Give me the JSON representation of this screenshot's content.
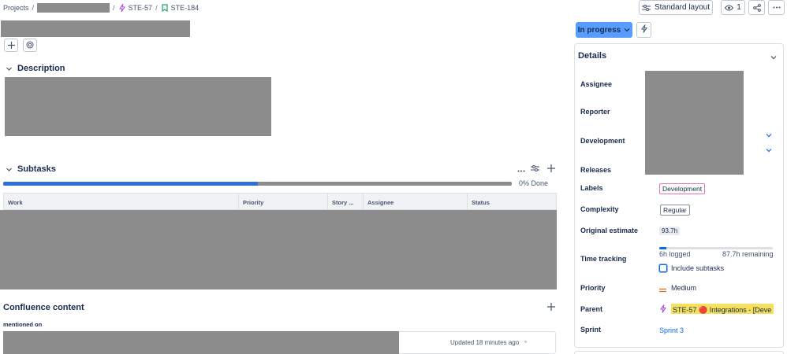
{
  "breadcrumb": {
    "projects": "Projects",
    "parent_key": "STE-57",
    "issue_key": "STE-184"
  },
  "header": {
    "layout_label": "Standard layout",
    "watchers_count": "1"
  },
  "description": {
    "title": "Description"
  },
  "subtasks": {
    "title": "Subtasks",
    "progress_text": "0% Done",
    "progress_fraction": 0.5,
    "columns": [
      "Work",
      "Priority",
      "Story ...",
      "Assignee",
      "Status"
    ]
  },
  "confluence": {
    "title": "Confluence content",
    "mentioned_label": "mentioned on",
    "updated_text": "Updated 18 minutes ago"
  },
  "status": {
    "label": "In progress"
  },
  "details": {
    "title": "Details",
    "assignee_label": "Assignee",
    "reporter_label": "Reporter",
    "development_label": "Development",
    "releases_label": "Releases",
    "labels_label": "Labels",
    "labels_value": "Development",
    "complexity_label": "Complexity",
    "complexity_value": "Regular",
    "estimate_label": "Original estimate",
    "estimate_value": "93.7h",
    "time_tracking_label": "Time tracking",
    "time_logged": "6h logged",
    "time_remaining": "87.7h remaining",
    "time_fraction": 0.064,
    "include_subtasks": "Include subtasks",
    "priority_label": "Priority",
    "priority_value": "Medium",
    "parent_label": "Parent",
    "parent_value": "STE-57 🔴 Integrations - [Deve",
    "sprint_label": "Sprint",
    "sprint_value": "Sprint 3"
  },
  "colors": {
    "accent": "#579dff",
    "progress": "#2f6fd8",
    "redacted": "#8c8c8c",
    "label_border": "#e2b203",
    "parent_highlight": "#f5e15d",
    "priority": "#e56910"
  }
}
